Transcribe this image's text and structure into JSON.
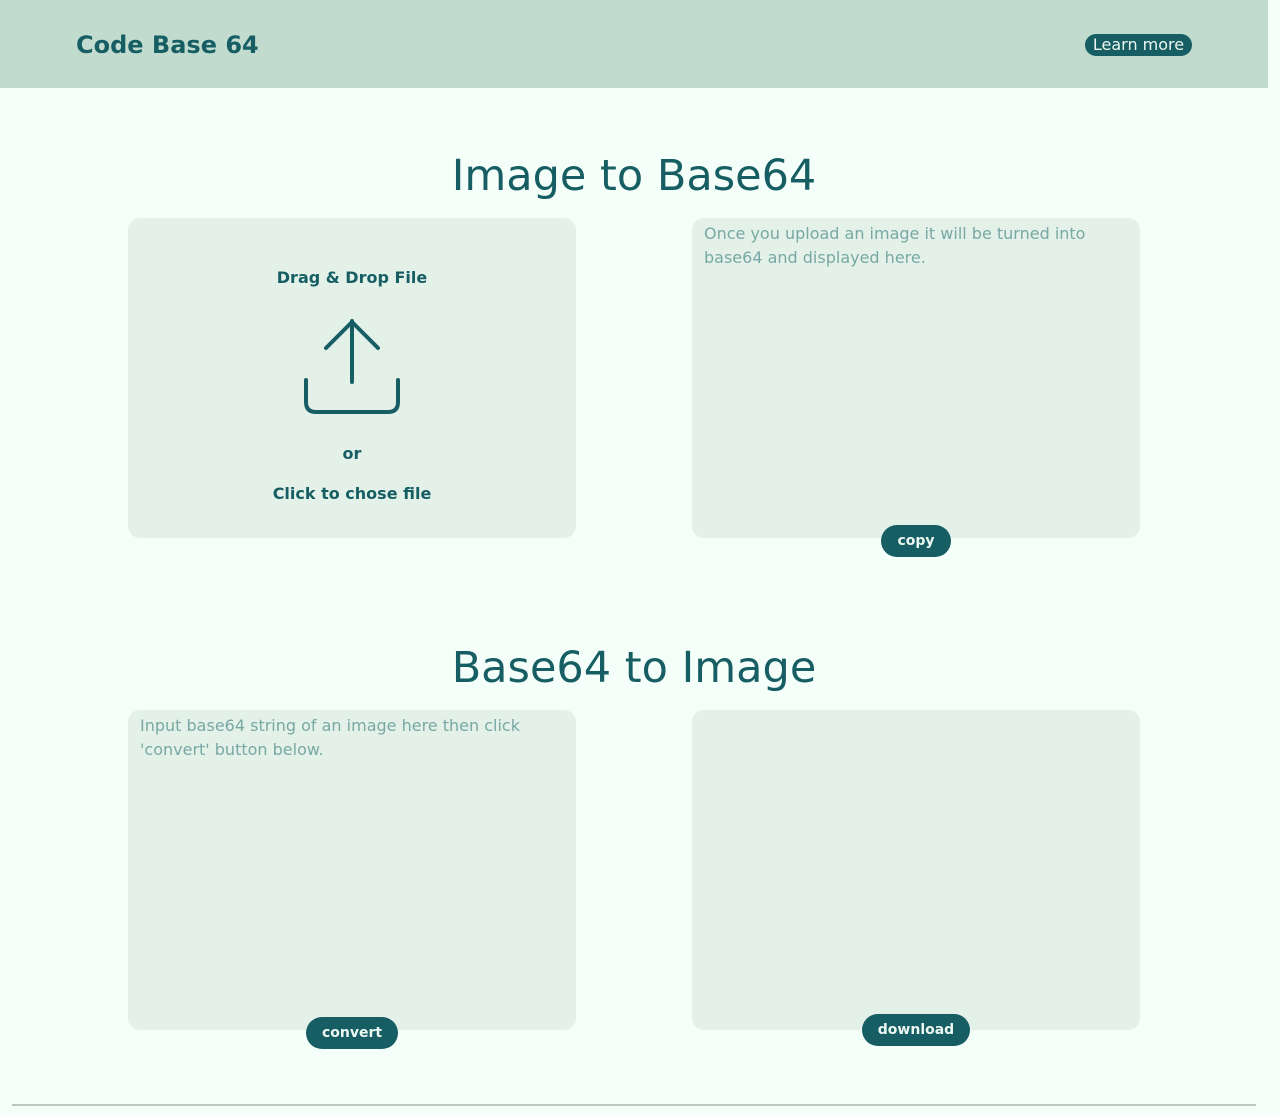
{
  "header": {
    "brand": "Code Base 64",
    "learn_more": "Learn more"
  },
  "image_to_base64": {
    "title": "Image to Base64",
    "drop_zone": {
      "title": "Drag & Drop File",
      "or": "or",
      "choose": "Click to chose file",
      "icon": "upload-icon"
    },
    "output_placeholder": "Once you upload an image it will be turned into base64 and displayed here.",
    "copy_label": "copy"
  },
  "base64_to_image": {
    "title": "Base64 to Image",
    "input_placeholder": "Input base64 string of an image here then click 'convert' button below.",
    "convert_label": "convert",
    "download_label": "download"
  },
  "colors": {
    "accent": "#165e63",
    "header_bg": "#c1dccf",
    "page_bg": "#f5fff9",
    "panel_bg": "#e3f1e9"
  }
}
